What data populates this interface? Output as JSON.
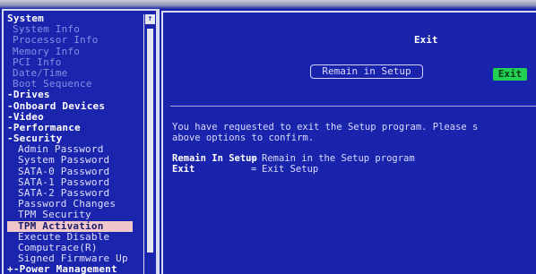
{
  "menu": {
    "items": [
      {
        "label": "System",
        "kind": "head"
      },
      {
        "label": "System Info",
        "kind": "dim"
      },
      {
        "label": "Processor Info",
        "kind": "dim"
      },
      {
        "label": "Memory Info",
        "kind": "dim"
      },
      {
        "label": "PCI Info",
        "kind": "dim"
      },
      {
        "label": "Date/Time",
        "kind": "dim"
      },
      {
        "label": "Boot Sequence",
        "kind": "dim"
      },
      {
        "label": "-Drives",
        "kind": "head"
      },
      {
        "label": "-Onboard Devices",
        "kind": "head"
      },
      {
        "label": "-Video",
        "kind": "head"
      },
      {
        "label": "-Performance",
        "kind": "head"
      },
      {
        "label": "-Security",
        "kind": "head"
      },
      {
        "label": "Admin Password",
        "kind": "sub"
      },
      {
        "label": "System Password",
        "kind": "sub"
      },
      {
        "label": "SATA-0 Password",
        "kind": "sub"
      },
      {
        "label": "SATA-1 Password",
        "kind": "sub"
      },
      {
        "label": "SATA-2 Password",
        "kind": "sub"
      },
      {
        "label": "Password Changes",
        "kind": "sub"
      },
      {
        "label": "TPM Security",
        "kind": "sub"
      },
      {
        "label": "TPM Activation",
        "kind": "sel"
      },
      {
        "label": "Execute Disable",
        "kind": "sub"
      },
      {
        "label": "Computrace(R)",
        "kind": "sub"
      },
      {
        "label": "Signed Firmware Up",
        "kind": "sub"
      },
      {
        "label": "+-Power Management",
        "kind": "head"
      }
    ],
    "scroll_up_glyph": "↑"
  },
  "dialog": {
    "title": "Exit",
    "remain_button": "Remain in Setup",
    "exit_button": "Exit",
    "message_line1": "You have requested to exit the Setup program. Please s",
    "message_line2": "above options to confirm.",
    "legend": [
      {
        "key": "Remain In Setup",
        "sep": "=",
        "desc": "Remain in the Setup program"
      },
      {
        "key": "Exit",
        "sep": "=",
        "desc": "Exit Setup"
      }
    ]
  },
  "colors": {
    "background": "#1a23ac",
    "selected_bg": "#f0c8cc",
    "exit_button_bg": "#22d052"
  }
}
